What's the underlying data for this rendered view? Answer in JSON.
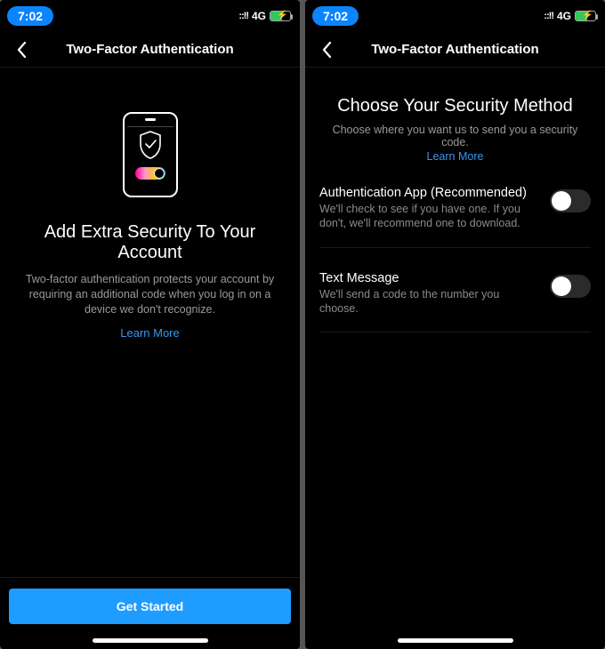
{
  "status": {
    "time": "7:02",
    "signal": "::!!",
    "network": "4G"
  },
  "left": {
    "header_title": "Two-Factor Authentication",
    "intro_title": "Add Extra Security To Your Account",
    "intro_body": "Two-factor authentication protects your account by requiring an additional code when you log in on a device we don't recognize.",
    "learn_more": "Learn More",
    "cta": "Get Started"
  },
  "right": {
    "header_title": "Two-Factor Authentication",
    "choose_title": "Choose Your Security Method",
    "choose_body": "Choose where you want us to send you a security code.",
    "learn_more": "Learn More",
    "options": [
      {
        "title": "Authentication App (Recommended)",
        "sub": "We'll check to see if you have one. If you don't, we'll recommend one to download.",
        "enabled": false
      },
      {
        "title": "Text Message",
        "sub": "We'll send a code to the number you choose.",
        "enabled": false
      }
    ]
  }
}
